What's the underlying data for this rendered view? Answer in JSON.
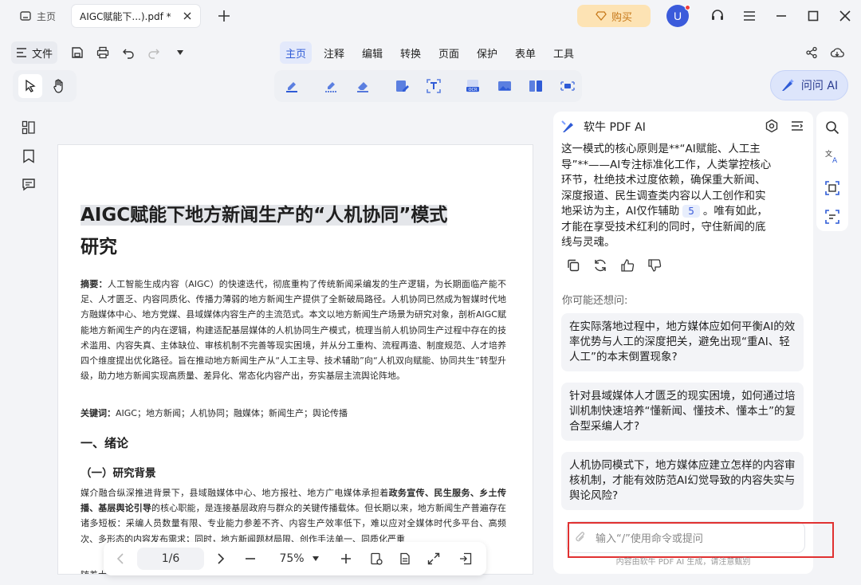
{
  "titlebar": {
    "home_tab": "主页",
    "doc_tab": "AIGC赋能下...).pdf *",
    "buy_label": "购买",
    "avatar_letter": "U"
  },
  "menubar": {
    "file_label": "文件",
    "items": [
      "主页",
      "注释",
      "编辑",
      "转换",
      "页面",
      "保护",
      "表单",
      "工具"
    ],
    "active": "主页"
  },
  "toolbar": {
    "ask_ai_label": "问问 AI"
  },
  "document": {
    "title_line1": "AIGC赋能下地方新闻生产的“人机协同”模式",
    "title_line2": "研究",
    "abstract_label": "摘要：",
    "abstract_text": "人工智能生成内容（AIGC）的快速迭代，彻底重构了传统新闻采编发的生产逻辑，为长期面临产能不足、人才匮乏、内容同质化、传播力薄弱的地方新闻生产提供了全新破局路径。人机协同已然成为智媒时代地方融媒体中心、地方党媒、县域媒体内容生产的主流范式。本文以地方新闻生产场景为研究对象，剖析AIGC赋能地方新闻生产的内在逻辑，构建适配基层媒体的人机协同生产模式，梳理当前人机协同生产过程中存在的技术滥用、内容失真、主体缺位、审核机制不完善等现实困境，并从分工重构、流程再造、制度规范、人才培养四个维度提出优化路径。旨在推动地方新闻生产从“人工主导、技术辅助”向“人机双向赋能、协同共生”转型升级，助力地方新闻实现高质量、差异化、常态化内容产出，夯实基层主流舆论阵地。",
    "keywords_label": "关键词：",
    "keywords_text": "AIGC；地方新闻；人机协同；融媒体；新闻生产；舆论传播",
    "h2": "一、绪论",
    "h3": "（一）研究背景",
    "body_p1_a": "媒介融合纵深推进背景下，县域融媒体中心、地方报社、地方广电媒体承担着",
    "body_p1_b": "政务宣传、民生服务、乡土传播、基层舆论引导",
    "body_p1_c": "的核心职能，是连接基层政府与群众的关键传播载体。但长期以来，地方新闻生产普遍存在诸多短板：采编人员数量有限、专业能力参差不齐、内容生产效率低下，难以应对全媒体时代多平台、高频次、多形态的内容发布需求；同时，地方新闻题材局限、创作手法单一、同质化严重",
    "body_p2": "随着大"
  },
  "pager": {
    "page_display": "1/6",
    "zoom": "75%"
  },
  "ai_panel": {
    "title": "软牛 PDF AI",
    "answer_before_ref": "这一模式的核心原则是**“AI赋能、人工主导”**——AI专注标准化工作，人类掌控核心环节，杜绝技术过度依赖，确保重大新闻、深度报道、民生调查类内容以人工创作和实地采访为主，AI仅作辅助",
    "ref_number": "5",
    "answer_after_ref": "。唯有如此，才能在享受技术红利的同时，守住新闻的底线与灵魂。",
    "suggest_label": "你可能还想问:",
    "suggestions": [
      "在实际落地过程中，地方媒体应如何平衡AI的效率优势与人工的深度把关，避免出现“重AI、轻人工”的本末倒置现象?",
      "针对县域媒体人才匮乏的现实困境，如何通过培训机制快速培养“懂新闻、懂技术、懂本土”的复合型采编人才?",
      "人机协同模式下，地方媒体应建立怎样的内容审核机制，才能有效防范AI幻觉导致的内容失实与舆论风险?"
    ],
    "input_placeholder": "输入“/”使用命令或提问",
    "footer": "内容由软牛 PDF AI 生成，请注意甄别"
  },
  "colors": {
    "accent": "#2f5bd6",
    "buy_bg": "#fde3b4",
    "highlight_box": "#e03131"
  }
}
